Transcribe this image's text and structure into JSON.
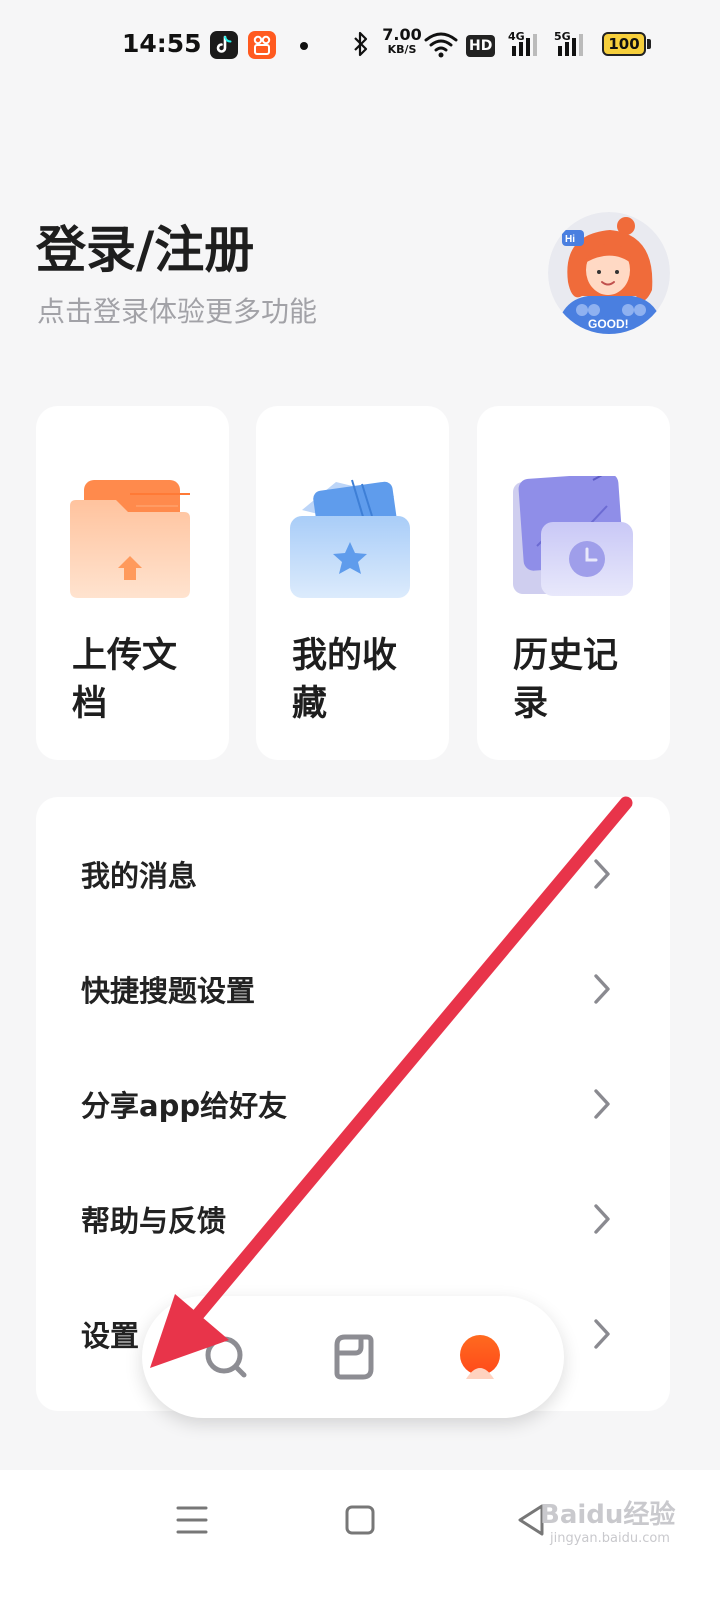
{
  "status_bar": {
    "time": "14:55",
    "network_speed": "7.00",
    "network_speed_unit": "KB/S",
    "hd_badge": "HD",
    "signal_1": "4G",
    "signal_2": "5G",
    "battery": "100",
    "icons": [
      "tiktok-app-icon",
      "kuaishou-app-icon",
      "notification-dot",
      "bluetooth-icon",
      "wifi-icon",
      "cellular-signal-icon",
      "battery-icon"
    ]
  },
  "header": {
    "title": "登录/注册",
    "subtitle": "点击登录体验更多功能"
  },
  "cards": [
    {
      "label": "上传文档",
      "icon": "upload-folder-icon",
      "color": "#ff9a5c"
    },
    {
      "label": "我的收藏",
      "icon": "favorites-star-folder-icon",
      "color": "#6aa8f2"
    },
    {
      "label": "历史记录",
      "icon": "history-clock-folder-icon",
      "color": "#8f8ee8"
    }
  ],
  "menu": [
    {
      "label": "我的消息"
    },
    {
      "label": "快捷搜题设置"
    },
    {
      "label": "分享app给好友"
    },
    {
      "label": "帮助与反馈"
    },
    {
      "label": "设置"
    }
  ],
  "tab_bar": {
    "tabs": [
      "search-tab",
      "documents-tab",
      "profile-tab"
    ],
    "active": "profile-tab",
    "accent": "#ff5a1f"
  },
  "annotation": {
    "color": "#e8344a"
  },
  "watermark": {
    "main": "Baidu经验",
    "sub": "jingyan.baidu.com"
  }
}
